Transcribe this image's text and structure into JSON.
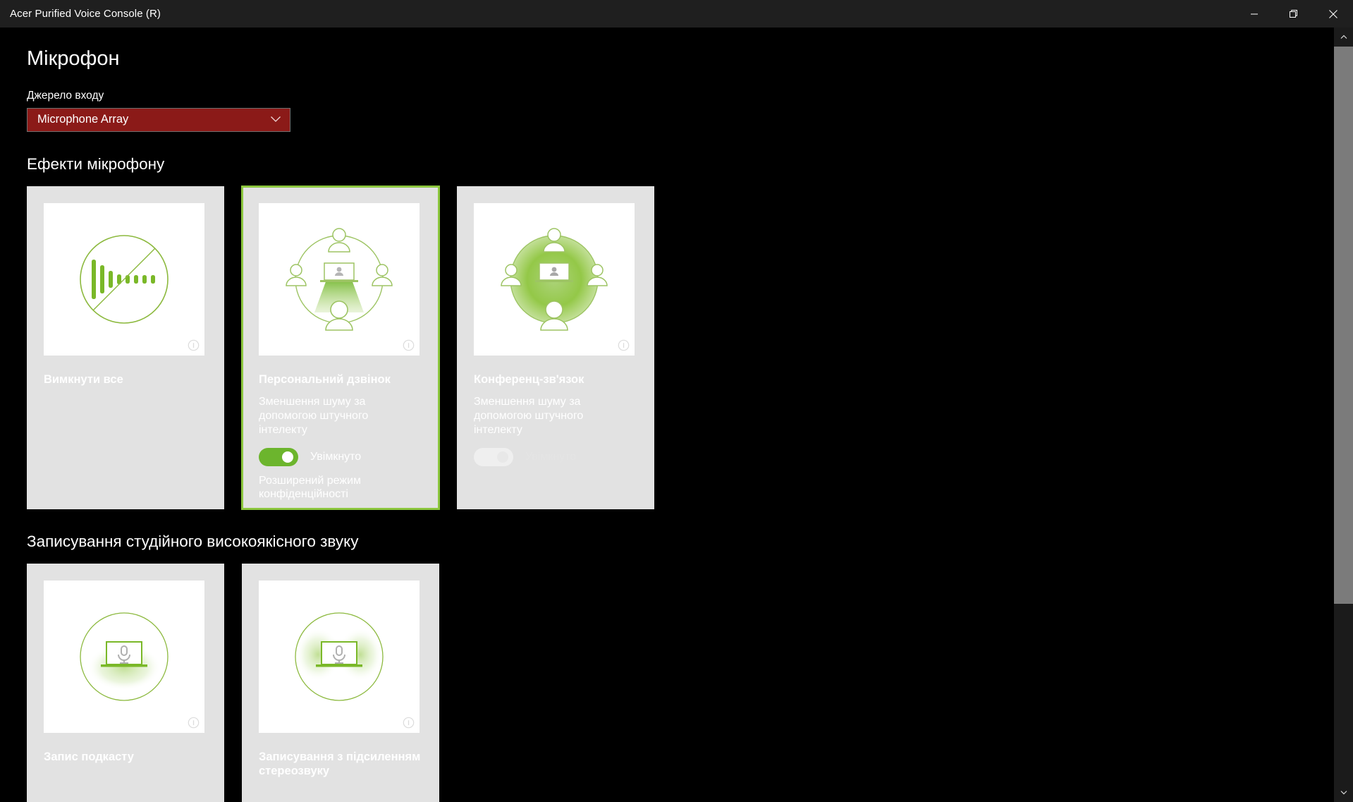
{
  "window": {
    "title": "Acer Purified Voice Console (R)",
    "controls": [
      {
        "name": "minimize-button",
        "icon": "minimize-icon"
      },
      {
        "name": "restore-button",
        "icon": "restore-icon"
      },
      {
        "name": "close-button",
        "icon": "close-icon"
      }
    ]
  },
  "page": {
    "title": "Мікрофон"
  },
  "input_source": {
    "label": "Джерело входу",
    "value": "Microphone Array",
    "chevron_icon": "chevron-down-icon",
    "background_color": "#8b1a18",
    "border_color": "#6f6f6f"
  },
  "effects_section": {
    "title": "Ефекти мікрофону",
    "cards": [
      {
        "title": "Вимкнути все",
        "icon": "mute-all-icon",
        "info_icon": "info-icon",
        "selected": false,
        "has_toggle": false,
        "description": "",
        "toggle_label": "",
        "toggle_on": false,
        "toggle_enabled": false,
        "extra_line": ""
      },
      {
        "title": "Персональний дзвінок",
        "icon": "personal-call-icon",
        "info_icon": "info-icon",
        "selected": true,
        "has_toggle": true,
        "description": "Зменшення шуму за допомогою штучного інтелекту",
        "toggle_label": "Увімкнуто",
        "toggle_on": true,
        "toggle_enabled": true,
        "extra_line": "Розширений режим конфіденційності"
      },
      {
        "title": "Конференц-зв'язок",
        "icon": "conference-call-icon",
        "info_icon": "info-icon",
        "selected": false,
        "has_toggle": true,
        "description": "Зменшення шуму за допомогою штучного інтелекту",
        "toggle_label": "Увімкнуто",
        "toggle_on": false,
        "toggle_enabled": false,
        "extra_line": ""
      }
    ]
  },
  "studio_section": {
    "title": "Записування студійного високоякісного звуку",
    "cards": [
      {
        "title": "Запис подкасту",
        "icon": "podcast-recording-icon",
        "info_icon": "info-icon",
        "selected": false
      },
      {
        "title": "Записування з підсиленням стереозвуку",
        "icon": "stereo-recording-icon",
        "info_icon": "info-icon",
        "selected": false
      }
    ]
  },
  "scrollbar": {
    "up_icon": "chevron-up-icon",
    "down_icon": "chevron-down-icon"
  },
  "colors": {
    "accent_green": "#8cc63e",
    "toggle_green": "#6cb52d",
    "card_bg": "#e2e2e2",
    "page_bg": "#000000",
    "titlebar_bg": "#1f1f1f"
  }
}
